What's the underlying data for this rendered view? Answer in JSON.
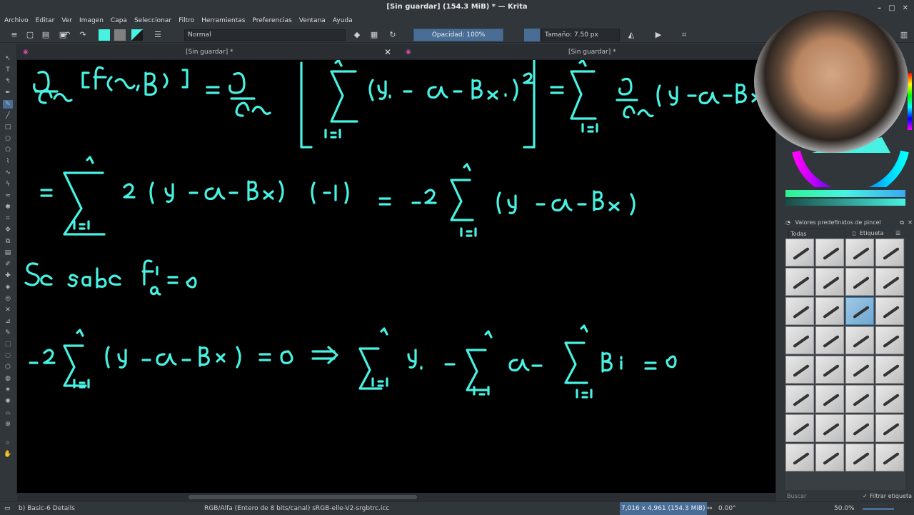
{
  "window": {
    "title": "[Sin guardar]  (154.3 MiB)  * — Krita",
    "controls": [
      "–",
      "□",
      "✕"
    ]
  },
  "menu": [
    "Archivo",
    "Editar",
    "Ver",
    "Imagen",
    "Capa",
    "Seleccionar",
    "Filtro",
    "Herramientas",
    "Preferencias",
    "Ventana",
    "Ayuda"
  ],
  "toolbar": {
    "blend_mode": "Normal",
    "opacity": "Opacidad: 100%",
    "size": "Tamaño: 7.50 px"
  },
  "tabs": [
    {
      "label": "[Sin guardar]  *"
    },
    {
      "label": "[Sin guardar]  *"
    }
  ],
  "canvas": {
    "ink_color": "#48f2e2",
    "background": "#000000",
    "line1": {
      "lhs": "∂/∂α [f(α, β)]",
      "mid": "= ∂/∂α [ Σ (yᵢ − α − βxᵢ)² ]",
      "rhs": "= Σ ∂/∂α (yᵢ − α − βxᵢ"
    },
    "line2": "= Σ 2 (yᵢ − α − βxᵢ) (−1) = −2 Σ (yᵢ − α − βxᵢ)",
    "line3": "Se sabe  f'α = 0",
    "line4": "−2 Σ (yᵢ − α − βᵢ) = 0  ⇒  Σ yᵢ − Σ α − Σ βᵢ = 0",
    "sum_upper": "n",
    "sum_lower": "i=1"
  },
  "right_panel": {
    "brush_presets_title": "Valores predefinidos de pincel",
    "filter_all": "Todas",
    "tag_label": "Etiqueta",
    "search_placeholder": "Buscar",
    "filter_tag": "Filtrar etiqueta"
  },
  "status": {
    "left": "b) Basic-6 Details",
    "color_space": "RGB/Alfa (Entero de 8 bits/canal)  sRGB-elle-V2-srgbtrc.icc",
    "dimensions": "7,016 x 4,961 (154.3 MiB)",
    "rotation": "0.00°",
    "zoom": "50.0%"
  },
  "colors": {
    "ui_bg": "#31363b",
    "accent": "#4a6d96",
    "fg_swatch": "#48f2e2",
    "bg_swatch": "#808080"
  }
}
